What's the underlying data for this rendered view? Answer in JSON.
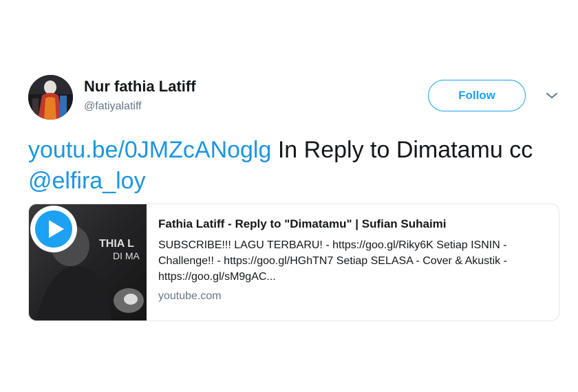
{
  "user": {
    "display_name": "Nur fathia Latiff",
    "handle": "@fatiyalatiff"
  },
  "header": {
    "follow_label": "Follow"
  },
  "tweet": {
    "link_text": "youtu.be/0JMZcANoglg",
    "text_middle": " In Reply to Dimatamu cc ",
    "mention": "@elfira_loy"
  },
  "card": {
    "title": "Fathia Latiff - Reply to \"Dimatamu\" | Sufian Suhaimi",
    "description": "SUBSCRIBE!!! LAGU TERBARU! - https://goo.gl/Riky6K Setiap ISNIN - Challenge!! - https://goo.gl/HGhTN7 Setiap SELASA - Cover & Akustik - https://goo.gl/sM9gAC...",
    "domain": "youtube.com",
    "thumbnail_text_line1": "THIA L",
    "thumbnail_text_line2": "DI MA"
  },
  "colors": {
    "accent": "#1da1f2",
    "link": "#1b95e0",
    "secondary_text": "#657786",
    "border": "#e1e8ed"
  },
  "icons": {
    "dropdown": "chevron-down-icon",
    "play": "play-icon"
  }
}
